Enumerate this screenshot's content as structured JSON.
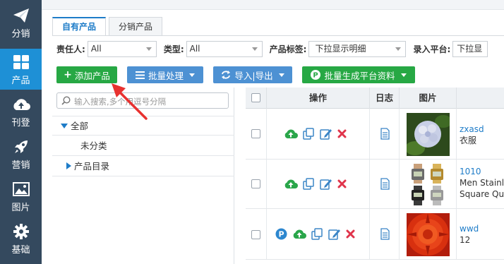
{
  "sidebar": {
    "items": [
      {
        "label": "分销",
        "icon": "paper-plane-icon"
      },
      {
        "label": "产品",
        "icon": "grid-icon",
        "active": true
      },
      {
        "label": "刊登",
        "icon": "cloud-upload-icon"
      },
      {
        "label": "营销",
        "icon": "rocket-icon"
      },
      {
        "label": "图片",
        "icon": "image-icon"
      },
      {
        "label": "基础",
        "icon": "gear-icon"
      }
    ]
  },
  "tabs": [
    {
      "label": "自有产品",
      "active": true
    },
    {
      "label": "分销产品",
      "active": false
    }
  ],
  "filters": {
    "owner_label": "责任人:",
    "owner_value": "All",
    "type_label": "类型:",
    "type_value": "All",
    "tag_label": "产品标签:",
    "tag_value": "下拉显示明细",
    "platform_label": "录入平台:",
    "platform_value": "下拉显"
  },
  "toolbar": {
    "add_label": "添加产品",
    "batch_label": "批量处理",
    "import_export_label": "导入|导出",
    "generate_label": "批量生成平台资料"
  },
  "tree": {
    "search_placeholder": "输入搜索,多个用逗号分隔",
    "all_label": "全部",
    "uncategorized_label": "未分类",
    "catalog_label": "产品目录"
  },
  "table": {
    "headers": {
      "operation": "操作",
      "log": "日志",
      "image": "图片"
    },
    "rows": [
      {
        "sku": "zxasd",
        "name_lines": [
          "衣服"
        ],
        "thumb": "hydrangea",
        "p_badge": false
      },
      {
        "sku": "1010",
        "name_lines": [
          "Men Stainle",
          "Square Qua"
        ],
        "thumb": "watches",
        "p_badge": true
      },
      {
        "sku": "wwd",
        "name_lines": [
          "12"
        ],
        "thumb": "red-flower",
        "p_badge": true
      }
    ]
  },
  "colors": {
    "sidebar_bg": "#34495e",
    "sidebar_active": "#1e90d6",
    "green_button": "#27a844",
    "blue_button": "#4d91d3",
    "link": "#1e7cc8",
    "delete_red": "#e0344b",
    "arrow_red": "#e8312f"
  }
}
